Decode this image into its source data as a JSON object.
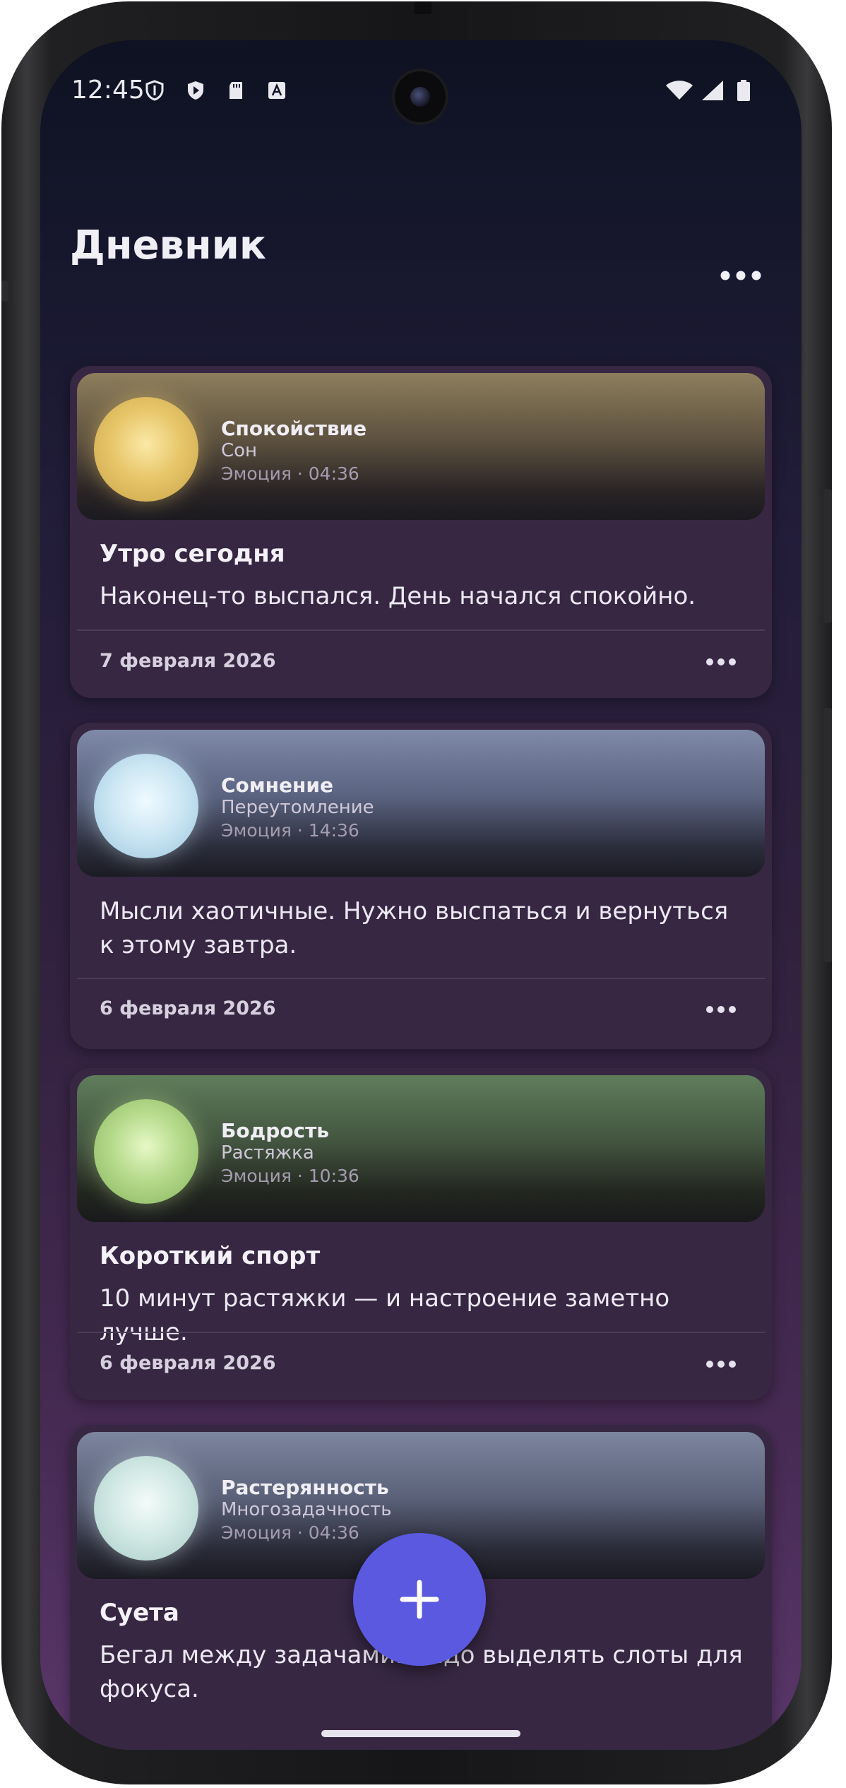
{
  "status_bar": {
    "time": "12:45",
    "left_icons": [
      "shield-icon",
      "play-protect-icon",
      "sd-card-icon",
      "font-icon"
    ],
    "right_icons": [
      "wifi-icon",
      "cellular-icon",
      "battery-icon"
    ]
  },
  "header": {
    "title": "Дневник",
    "menu_icon": "more-horizontal-icon"
  },
  "entries": [
    {
      "emotion": "Спокойствие",
      "tag": "Сон",
      "meta": "Эмоция · 04:36",
      "orb_color": "#e6c86a",
      "hero_color": "#8f7f5c",
      "title": "Утро сегодня",
      "text": "Наконец-то выспался. День начался спокойно.",
      "date": "7 февраля 2026"
    },
    {
      "emotion": "Сомнение",
      "tag": "Переутомление",
      "meta": "Эмоция · 14:36",
      "orb_color": "#cde6f3",
      "hero_color": "#7a86a6",
      "title": "",
      "text": "Мысли хаотичные. Нужно выспаться и вернуться к этому завтра.",
      "date": "6 февраля 2026"
    },
    {
      "emotion": "Бодрость",
      "tag": "Растяжка",
      "meta": "Эмоция · 10:36",
      "orb_color": "#b7dc8c",
      "hero_color": "#5f7c5b",
      "title": "Короткий спорт",
      "text": "10 минут растяжки — и настроение заметно лучше.",
      "date": "6 февраля 2026"
    },
    {
      "emotion": "Растерянность",
      "tag": "Многозадачность",
      "meta": "Эмоция · 04:36",
      "orb_color": "#d6ece9",
      "hero_color": "#7c859d",
      "title": "Суета",
      "text": "Бегал между задачами. Надо выделять слоты для фокуса.",
      "date": ""
    }
  ],
  "fab": {
    "icon": "plus-icon",
    "color": "#5a59e0"
  }
}
